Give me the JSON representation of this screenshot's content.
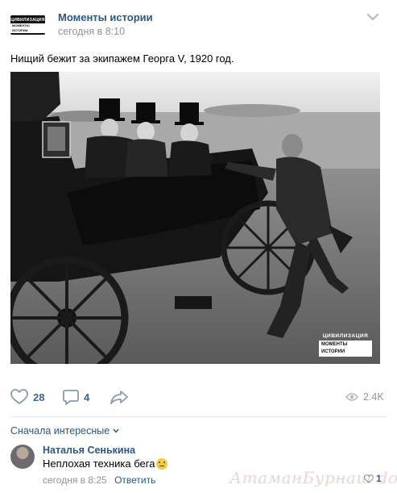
{
  "post": {
    "group_name": "Моменты истории",
    "time": "сегодня в 8:10",
    "text": "Нищий бежит за экипажем Георга V, 1920 год.",
    "avatar_text": [
      "ЦИВИЛИЗАЦИЯ",
      "МОМЕНТЫ ИСТОРИИ"
    ],
    "photo_watermark": [
      "ЦИВИЛИЗАЦИЯ",
      "МОМЕНТЫ ИСТОРИИ"
    ]
  },
  "actions": {
    "likes": "28",
    "comments": "4",
    "views": "2.4K"
  },
  "comments_section": {
    "sort_label": "Сначала интересные",
    "items": [
      {
        "author": "Наталья Сенькина",
        "text": "Неплохая техника бега",
        "time": "сегодня в 8:25",
        "reply_label": "Ответить",
        "likes": "1"
      }
    ]
  },
  "site_watermark": "АтаманБурнаш dok.RU",
  "colors": {
    "link": "#2a5885",
    "meta": "#939393",
    "action": "#42648b",
    "divider": "#e7e8ec"
  }
}
